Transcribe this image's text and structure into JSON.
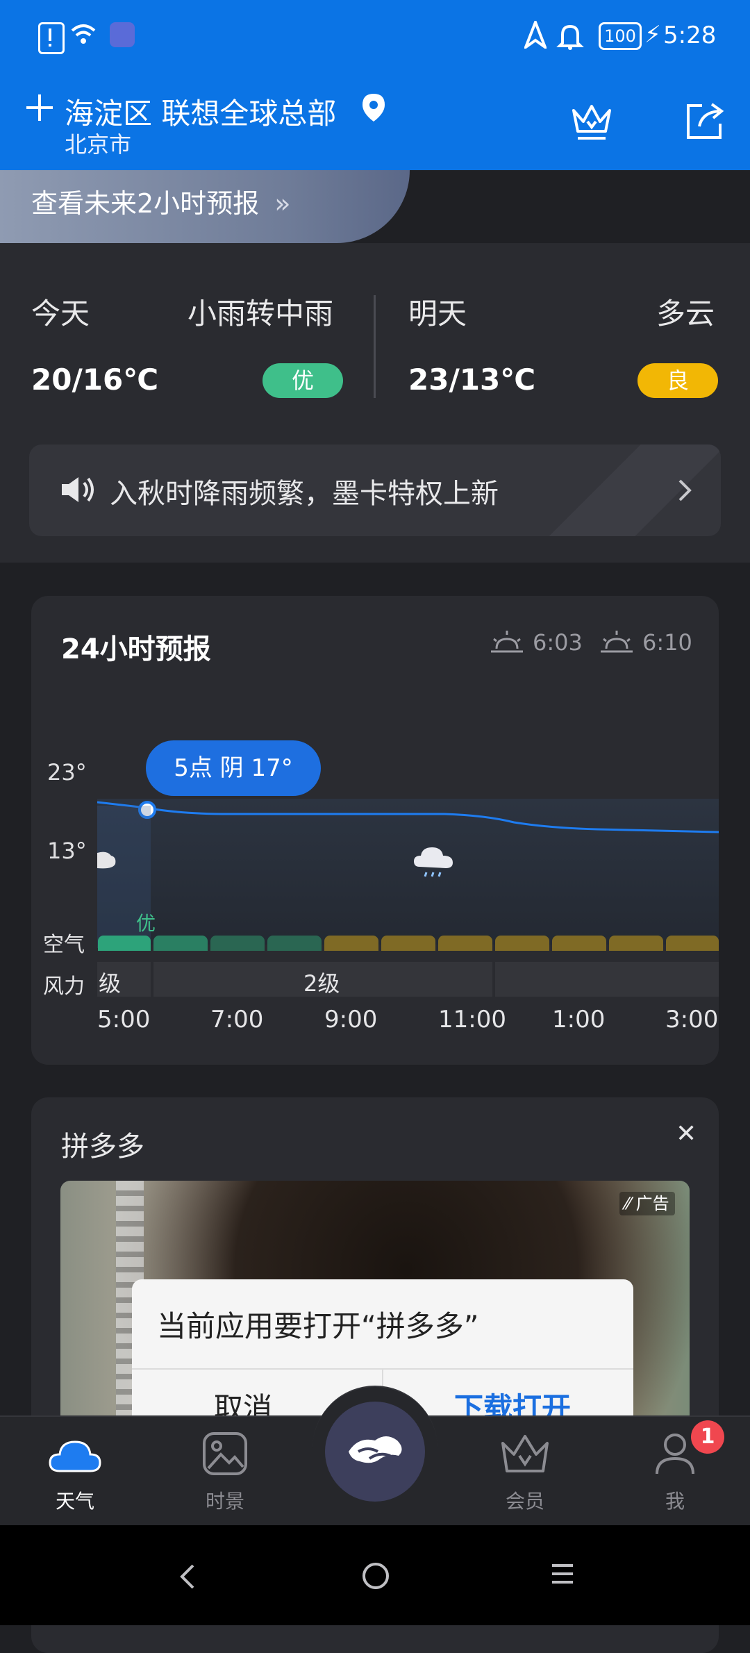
{
  "status_bar": {
    "battery": "100",
    "time": "5:28"
  },
  "header": {
    "location": "海淀区 联想全球总部",
    "city": "北京市",
    "icons": [
      "plus-icon",
      "location-pin-icon",
      "crown-icon",
      "share-icon"
    ]
  },
  "two_hour": {
    "label": "查看未来2小时预报"
  },
  "today": {
    "label": "今天",
    "weather": "小雨转中雨",
    "temp": "20/16℃",
    "aqi": "优",
    "aqi_color": "#3fbf8a"
  },
  "tomorrow": {
    "label": "明天",
    "weather": "多云",
    "temp": "23/13℃",
    "aqi": "良",
    "aqi_color": "#f2b705"
  },
  "banner": {
    "text": "入秋时降雨频繁，墨卡特权上新"
  },
  "forecast24": {
    "title": "24小时预报",
    "sunrise": "6:03",
    "sunset": "6:10",
    "tooltip": "5点 阴 17°",
    "y_labels": [
      "23°",
      "13°"
    ],
    "aq_label": "空气",
    "aq_value": "优",
    "wind_label": "风力",
    "wind_segments": [
      "级",
      "2级",
      ""
    ],
    "times": [
      "5:00",
      "7:00",
      "9:00",
      "11:00",
      "1:00",
      "3:00"
    ]
  },
  "ad": {
    "title": "拼多多",
    "tag": "广告",
    "dialog_title": "当前应用要打开“拼多多”",
    "cancel": "取消",
    "confirm": "下载打开"
  },
  "bottom_nav": {
    "items": [
      {
        "label": "天气",
        "active": true
      },
      {
        "label": "时景",
        "active": false
      },
      {
        "label": "",
        "active": false
      },
      {
        "label": "会员",
        "active": false
      },
      {
        "label": "我",
        "active": false,
        "badge": "1"
      }
    ]
  }
}
